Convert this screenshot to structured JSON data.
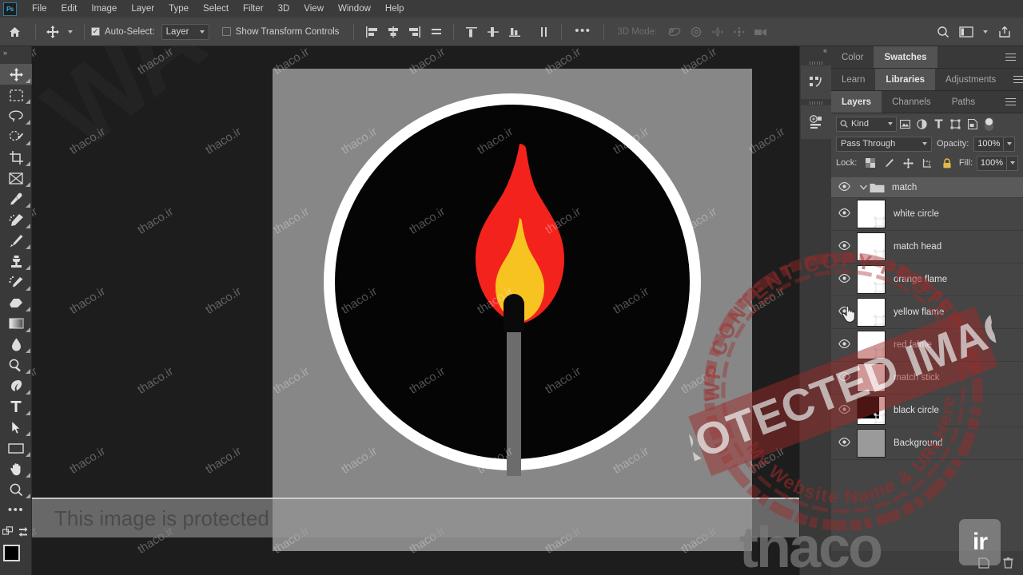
{
  "app": {
    "logo": "Ps"
  },
  "menubar": {
    "items": [
      "File",
      "Edit",
      "Image",
      "Layer",
      "Type",
      "Select",
      "Filter",
      "3D",
      "View",
      "Window",
      "Help"
    ]
  },
  "options_bar": {
    "home_icon": "home-icon",
    "active_tool_icon": "move-tool-icon",
    "auto_select_checked": true,
    "auto_select_label": "Auto-Select:",
    "auto_select_value": "Layer",
    "show_transform_label": "Show Transform Controls",
    "show_transform_checked": false,
    "align_icons": [
      "align-left-icon",
      "align-horizontal-center-icon",
      "align-right-icon",
      "distribute-horizontal-icon"
    ],
    "align_icons2": [
      "align-top-icon",
      "align-vertical-center-icon",
      "align-bottom-icon",
      "distribute-vertical-icon"
    ],
    "more_label": "•••",
    "mode_3d_label": "3D Mode:",
    "mode_3d_icons": [
      "orbit-3d-icon",
      "roll-3d-icon",
      "pan-3d-icon",
      "slide-3d-icon",
      "zoom-3d-icon"
    ],
    "right_icons": [
      "search-icon",
      "workspace-icon",
      "chevron-down-icon",
      "share-icon"
    ]
  },
  "toolbar": {
    "collapse_label": "»",
    "tools": [
      {
        "name": "move-tool",
        "icon": "move-icon",
        "active": true
      },
      {
        "name": "marquee-tool",
        "icon": "rectangular-marquee-icon",
        "active": false
      },
      {
        "name": "lasso-tool",
        "icon": "lasso-icon",
        "active": false
      },
      {
        "name": "quick-selection-tool",
        "icon": "quick-selection-icon",
        "active": false
      },
      {
        "name": "crop-tool",
        "icon": "crop-icon",
        "active": false
      },
      {
        "name": "frame-tool",
        "icon": "frame-icon",
        "active": false
      },
      {
        "name": "eyedropper-tool",
        "icon": "eyedropper-icon",
        "active": false
      },
      {
        "name": "healing-brush-tool",
        "icon": "healing-brush-icon",
        "active": false
      },
      {
        "name": "brush-tool",
        "icon": "brush-icon",
        "active": false
      },
      {
        "name": "clone-stamp-tool",
        "icon": "clone-stamp-icon",
        "active": false
      },
      {
        "name": "history-brush-tool",
        "icon": "history-brush-icon",
        "active": false
      },
      {
        "name": "eraser-tool",
        "icon": "eraser-icon",
        "active": false
      },
      {
        "name": "gradient-tool",
        "icon": "gradient-icon",
        "active": false
      },
      {
        "name": "blur-tool",
        "icon": "blur-drop-icon",
        "active": false
      },
      {
        "name": "dodge-tool",
        "icon": "dodge-icon",
        "active": false
      },
      {
        "name": "pen-tool",
        "icon": "pen-icon",
        "active": false
      },
      {
        "name": "type-tool",
        "icon": "type-t-icon",
        "active": false
      },
      {
        "name": "path-selection-tool",
        "icon": "path-arrow-icon",
        "active": false
      },
      {
        "name": "rectangle-tool",
        "icon": "rectangle-icon",
        "active": false
      },
      {
        "name": "hand-tool",
        "icon": "hand-icon",
        "active": false
      },
      {
        "name": "zoom-tool",
        "icon": "magnifier-icon",
        "active": false
      }
    ],
    "more_tools_label": "•••",
    "edit_toolbar_icon": "edit-toolbar-icon",
    "swap_colors_icon": "swap-colors-icon",
    "foreground_color": "#000000",
    "background_color": "#ffffff"
  },
  "canvas": {
    "background_color": "#878787",
    "artwork": {
      "white_circle_color": "#ffffff",
      "black_circle_color": "#050505",
      "red_flame_color": "#F4221C",
      "yellow_flame_color": "#F7C320",
      "match_stick_color": "#6c6c6c",
      "match_head_color": "#0a0a0a"
    },
    "watermark_big": "WA",
    "watermark_tile": "thaco.ir",
    "protected_banner": "This image is protected"
  },
  "rail": {
    "collapse_label": "«",
    "buttons": [
      {
        "name": "history-panel-icon"
      },
      {
        "name": "properties-panel-icon"
      }
    ]
  },
  "panels": {
    "row1": {
      "tabs": [
        {
          "label": "Color",
          "active": false
        },
        {
          "label": "Swatches",
          "active": true
        }
      ],
      "menu_icon": "panel-menu-icon"
    },
    "row2": {
      "tabs": [
        {
          "label": "Learn",
          "active": false
        },
        {
          "label": "Libraries",
          "active": true
        },
        {
          "label": "Adjustments",
          "active": false
        }
      ],
      "menu_icon": "panel-menu-icon"
    },
    "row3": {
      "tabs": [
        {
          "label": "Layers",
          "active": true
        },
        {
          "label": "Channels",
          "active": false
        },
        {
          "label": "Paths",
          "active": false
        }
      ],
      "menu_icon": "panel-menu-icon"
    }
  },
  "layers_panel": {
    "filter": {
      "search_icon": "search-icon",
      "kind_label": "Kind",
      "chevron": "chevron-down-icon",
      "type_icons": [
        "pixel-layer-filter-icon",
        "adjustment-layer-filter-icon",
        "type-layer-filter-icon",
        "shape-layer-filter-icon",
        "smart-object-filter-icon"
      ],
      "toggle_name": "filter-enable-toggle"
    },
    "blend_mode": "Pass Through",
    "opacity_label": "Opacity:",
    "opacity_value": "100%",
    "lock_label": "Lock:",
    "lock_icons": [
      "lock-transparent-pixels-icon",
      "lock-image-pixels-icon",
      "lock-position-icon",
      "lock-artboard-nesting-icon",
      "lock-all-icon"
    ],
    "fill_label": "Fill:",
    "fill_value": "100%",
    "layers": [
      {
        "name": "match",
        "type": "group",
        "visible": true,
        "selected": true,
        "expanded": true
      },
      {
        "name": "white circle",
        "type": "shape",
        "visible": true,
        "thumb": "white"
      },
      {
        "name": "match head",
        "type": "shape",
        "visible": true,
        "thumb": "white"
      },
      {
        "name": "orange flame",
        "type": "shape",
        "visible": true,
        "thumb": "white"
      },
      {
        "name": "yellow flame",
        "type": "shape",
        "visible": true,
        "thumb": "white"
      },
      {
        "name": "red falme",
        "type": "shape",
        "visible": true,
        "thumb": "white"
      },
      {
        "name": "match stick",
        "type": "shape",
        "visible": true,
        "thumb": "white"
      },
      {
        "name": "black circle",
        "type": "shape",
        "visible": true,
        "thumb": "black"
      },
      {
        "name": "Background",
        "type": "raster",
        "visible": true,
        "thumb": "gray"
      }
    ],
    "bottom_icons": [
      "new-layer-icon",
      "delete-layer-icon"
    ]
  },
  "overlay": {
    "stamp_center_text": "PROTECTED IMAGE",
    "stamp_outer_text": "WP CONTENT COPY PROTECTION PLUGIN",
    "stamp_bottom_text": "My Website Name & URLHere",
    "stamp_color": "#a02a2a",
    "site_text": "thaco",
    "site_tld": "ir",
    "cursor": "pointing-hand-cursor"
  }
}
